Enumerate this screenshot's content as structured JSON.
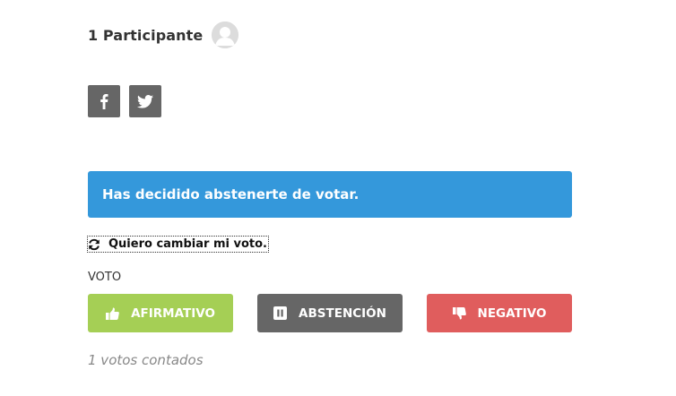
{
  "participants": {
    "label": "1 Participante"
  },
  "social": {
    "facebook_icon": "facebook-icon",
    "twitter_icon": "twitter-icon"
  },
  "alert": {
    "message": "Has decidido abstenerte de votar.",
    "color": "#3498db"
  },
  "change_vote": {
    "label": "Quiero cambiar mi voto.",
    "icon": "refresh-icon"
  },
  "vote": {
    "section_label": "VOTO",
    "buttons": [
      {
        "label": "AFIRMATIVO",
        "icon": "thumbs-up-icon",
        "color": "#a5cf55"
      },
      {
        "label": "ABSTENCIÓN",
        "icon": "pause-icon",
        "color": "#666666"
      },
      {
        "label": "NEGATIVO",
        "icon": "thumbs-down-icon",
        "color": "#e05d5d"
      }
    ],
    "count_text": "1 votos contados"
  }
}
